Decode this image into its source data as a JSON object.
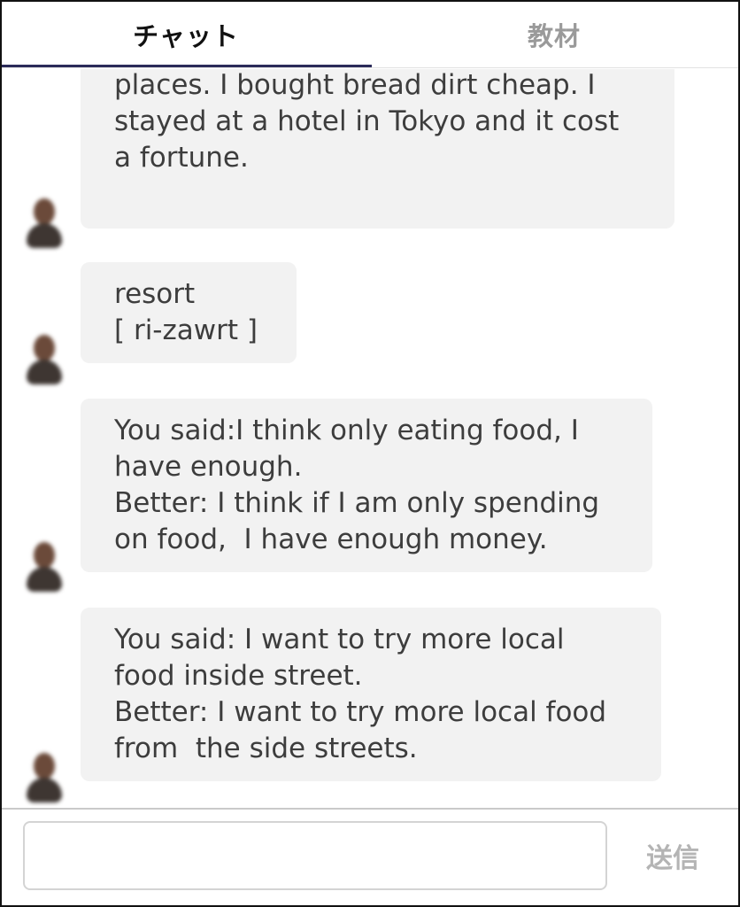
{
  "tabs": [
    {
      "label": "チャット",
      "active": true
    },
    {
      "label": "教材",
      "active": false
    }
  ],
  "messages": [
    {
      "lines": [
        "places. I bought bread dirt cheap. I",
        "stayed at a hotel in Tokyo and it cost",
        "a fortune."
      ]
    },
    {
      "lines": [
        "resort",
        "[ ri-zawrt ]"
      ]
    },
    {
      "lines": [
        "You said:I think only eating food, I",
        "have enough.",
        "Better: I think if I am only spending",
        "on food,  I have enough money."
      ]
    },
    {
      "lines": [
        "You said: I want to try more local",
        "food inside street.",
        "Better: I want to try more local food",
        "from  the side streets."
      ]
    }
  ],
  "composer": {
    "value": "",
    "placeholder": "",
    "send_label": "送信"
  },
  "colors": {
    "tab_indicator": "#2b2b5a",
    "bubble_bg": "#f2f2f2",
    "send_disabled": "#b4b4b4"
  },
  "icons": {
    "avatar": "user-avatar-photo"
  }
}
